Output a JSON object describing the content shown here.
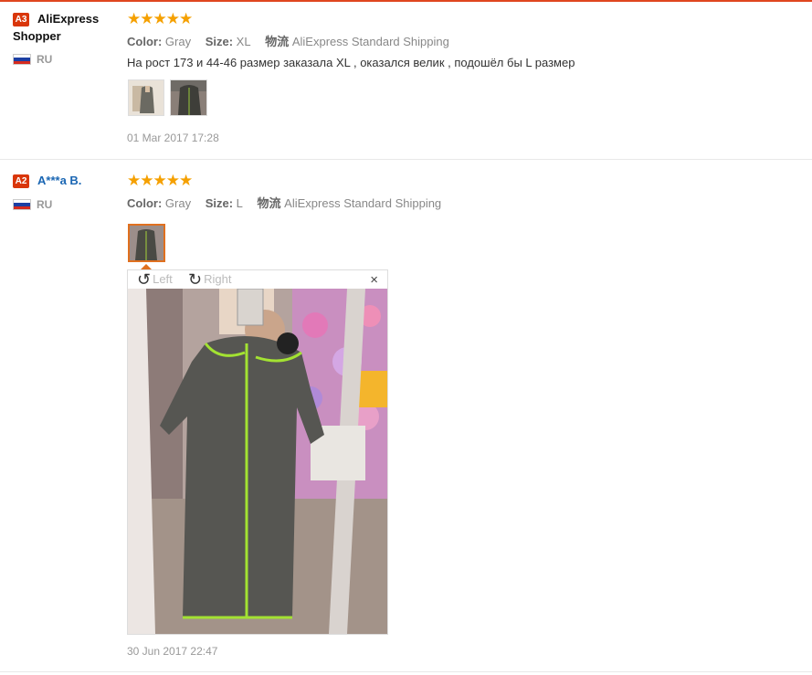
{
  "reviews": [
    {
      "badge": "A3",
      "user": "AliExpress Shopper",
      "user_line1": "AliExpress",
      "user_line2": "Shopper",
      "country": "RU",
      "rating_stars": "★★★★★",
      "color_label": "Color:",
      "color_value": "Gray",
      "size_label": "Size:",
      "size_value": "XL",
      "shipping_label": "物流",
      "shipping_value": "AliExpress Standard Shipping",
      "text": "На рост 173 и 44-46 размер заказала XL , оказался велик , подошёл бы L размер",
      "date": "01 Mar 2017 17:28"
    },
    {
      "badge": "A2",
      "user": "A***a B.",
      "country": "RU",
      "rating_stars": "★★★★★",
      "color_label": "Color:",
      "color_value": "Gray",
      "size_label": "Size:",
      "size_value": "L",
      "shipping_label": "物流",
      "shipping_value": "AliExpress Standard Shipping",
      "date": "30 Jun 2017 22:47"
    }
  ],
  "viewer": {
    "rotate_left": "Left",
    "rotate_right": "Right",
    "close": "×"
  },
  "colors": {
    "accent": "#e0461f",
    "star": "#f5a000",
    "link": "#1a66b3"
  },
  "icons": {
    "rotate_left": "rotate-left-icon",
    "rotate_right": "rotate-right-icon",
    "close": "close-icon",
    "flag": "russia-flag-icon"
  }
}
